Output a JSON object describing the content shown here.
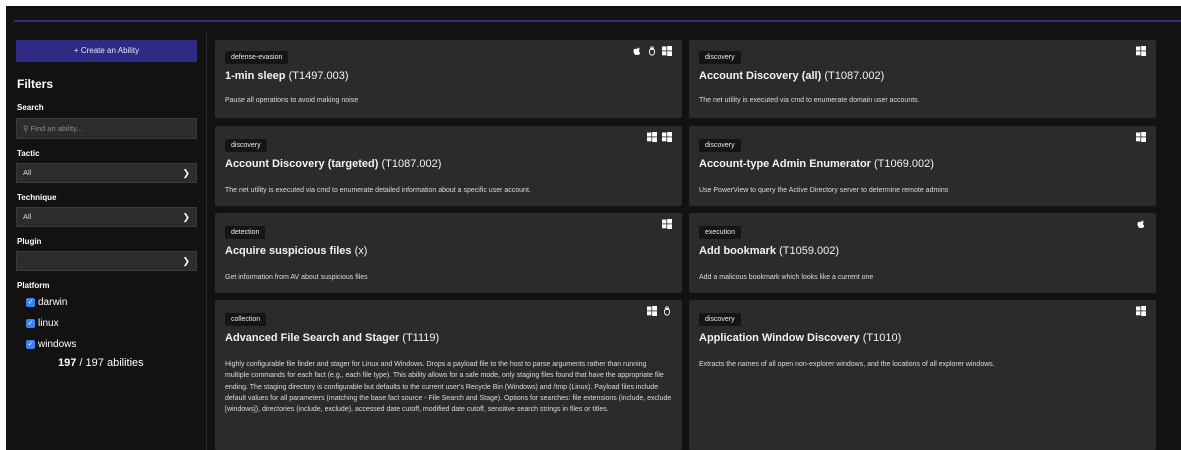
{
  "sidebar": {
    "create_label": "+ Create an Ability",
    "filters_title": "Filters",
    "search_label": "Search",
    "search_placeholder": "Find an ability...",
    "tactic_label": "Tactic",
    "tactic_value": "All",
    "technique_label": "Technique",
    "technique_value": "All",
    "plugin_label": "Plugin",
    "plugin_value": "",
    "platform_label": "Platform",
    "platforms": [
      "darwin",
      "linux",
      "windows"
    ],
    "count_shown": "197",
    "count_sep": "/",
    "count_total": "197",
    "count_suffix": "abilities"
  },
  "cards": [
    {
      "tag": "defense-evasion",
      "name": "1-min sleep",
      "tid": "(T1497.003)",
      "desc": "Pause all operations to avoid making noise",
      "icons": [
        "apple-icon",
        "linux-icon",
        "windows-icon"
      ]
    },
    {
      "tag": "discovery",
      "name": "Account Discovery (all)",
      "tid": "(T1087.002)",
      "desc": "The net utility is executed via cmd to enumerate domain user accounts.",
      "icons": [
        "windows-icon"
      ]
    },
    {
      "tag": "discovery",
      "name": "Account Discovery (targeted)",
      "tid": "(T1087.002)",
      "desc": "The net utility is executed via cmd to enumerate detailed information about a specific user account.",
      "icons": [
        "windows-icon",
        "windows-icon"
      ]
    },
    {
      "tag": "discovery",
      "name": "Account-type Admin Enumerator",
      "tid": "(T1069.002)",
      "desc": "Use PowerView to query the Active Directory server to determine remote admins",
      "icons": [
        "windows-icon"
      ]
    },
    {
      "tag": "detection",
      "name": "Acquire suspicious files",
      "tid": "(x)",
      "desc": "Get information from AV about suspicious files",
      "icons": [
        "windows-icon"
      ]
    },
    {
      "tag": "execution",
      "name": "Add bookmark",
      "tid": "(T1059.002)",
      "desc": "Add a malicous bookmark which looks like a current one",
      "icons": [
        "apple-icon"
      ]
    },
    {
      "tag": "collection",
      "name": "Advanced File Search and Stager",
      "tid": "(T1119)",
      "desc": "Highly configurable file finder and stager for Linux and Windows. Drops a payload file to the host to parse arguments rather than running multiple commands for each fact (e.g., each file type). This ability allows for a safe mode, only staging files found that have the appropriate file ending. The staging directory is configurable but defaults to the current user's Recycle Bin (Windows) and /tmp (Linux). Payload files include default values for all parameters (matching the base fact source - File Search and Stage). Options for searches: file extensions (include, exclude [windows]), directories (include, exclude), accessed date cutoff, modified date cutoff, sensitive search strings in files or titles.",
      "icons": [
        "windows-icon",
        "linux-icon"
      ]
    },
    {
      "tag": "discovery",
      "name": "Application Window Discovery",
      "tid": "(T1010)",
      "desc": "Extracts the names of all open non-explorer windows, and the locations of all explorer windows.",
      "icons": [
        "windows-icon"
      ]
    }
  ]
}
